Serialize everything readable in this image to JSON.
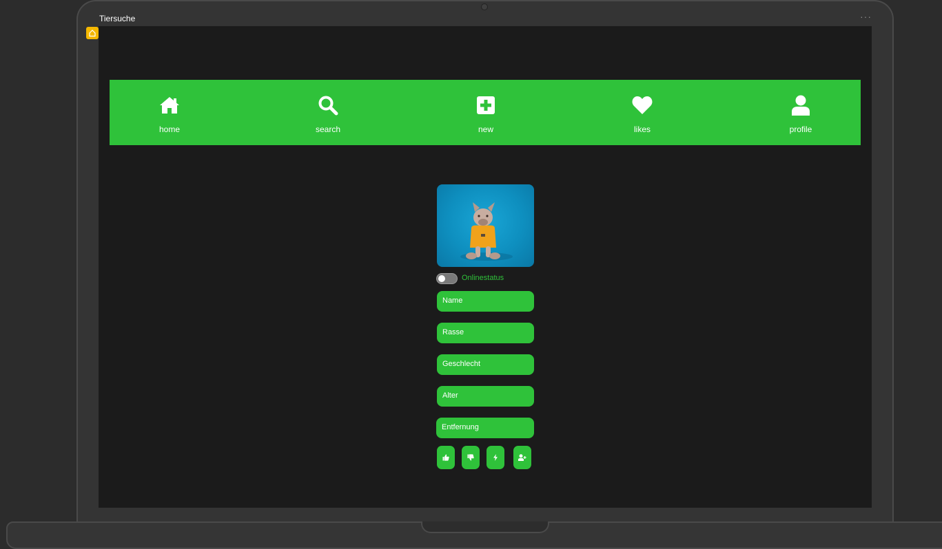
{
  "window": {
    "title": "Tiersuche",
    "menu_glyph": "···"
  },
  "navbar": {
    "background": "#2fc23a",
    "items": [
      {
        "label": "home",
        "icon": "home-icon"
      },
      {
        "label": "search",
        "icon": "search-icon"
      },
      {
        "label": "new",
        "icon": "plus-square-icon"
      },
      {
        "label": "likes",
        "icon": "heart-icon"
      },
      {
        "label": "profile",
        "icon": "user-icon"
      }
    ]
  },
  "profile": {
    "photo": "french-bulldog-photo",
    "online_toggle": {
      "label": "Onlinestatus",
      "on": false
    },
    "fields": [
      {
        "placeholder": "Name"
      },
      {
        "placeholder": "Rasse"
      },
      {
        "placeholder": "Geschlecht"
      },
      {
        "placeholder": "Alter"
      },
      {
        "placeholder": "Entfernung"
      }
    ],
    "actions": [
      {
        "icon": "thumbs-up-icon"
      },
      {
        "icon": "thumbs-down-icon"
      },
      {
        "icon": "bolt-icon"
      },
      {
        "icon": "add-friend-icon"
      }
    ]
  },
  "colors": {
    "accent": "#2fc23a",
    "screen_bg": "#1b1b1b",
    "badge": "#f5b800"
  }
}
